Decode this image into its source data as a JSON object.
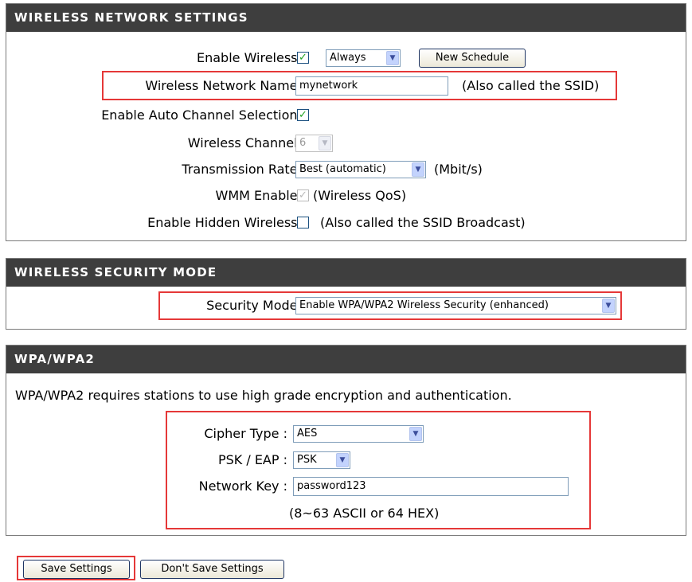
{
  "wireless_settings": {
    "title": "WIRELESS NETWORK SETTINGS",
    "enable_wireless_label": "Enable Wireless :",
    "enable_wireless_checked": true,
    "schedule_value": "Always",
    "new_schedule_label": "New Schedule",
    "network_name_label": "Wireless Network Name :",
    "network_name_value": "mynetwork",
    "network_name_note": "(Also called the SSID)",
    "auto_channel_label": "Enable Auto Channel Selection :",
    "auto_channel_checked": true,
    "channel_label": "Wireless Channel :",
    "channel_value": "6",
    "rate_label": "Transmission Rate :",
    "rate_value": "Best (automatic)",
    "rate_unit": "(Mbit/s)",
    "wmm_label": "WMM Enable :",
    "wmm_checked": true,
    "wmm_note": "(Wireless QoS)",
    "hidden_label": "Enable Hidden Wireless :",
    "hidden_checked": false,
    "hidden_note": "(Also called the SSID Broadcast)"
  },
  "security_mode": {
    "title": "WIRELESS SECURITY MODE",
    "label": "Security Mode :",
    "value": "Enable WPA/WPA2 Wireless Security (enhanced)"
  },
  "wpa": {
    "title": "WPA/WPA2",
    "description": "WPA/WPA2 requires stations to use high grade encryption and authentication.",
    "cipher_label": "Cipher Type :",
    "cipher_value": "AES",
    "psk_eap_label": "PSK / EAP :",
    "psk_eap_value": "PSK",
    "network_key_label": "Network Key :",
    "network_key_value": "password123",
    "key_hint": "(8~63 ASCII or 64 HEX)"
  },
  "actions": {
    "save_label": "Save Settings",
    "dont_save_label": "Don't Save Settings"
  },
  "colors": {
    "header_bg": "#3e3e3e",
    "highlight": "#e53838",
    "check": "#21a121"
  },
  "icons": {
    "checkmark": "✓",
    "dropdown": "▼"
  }
}
